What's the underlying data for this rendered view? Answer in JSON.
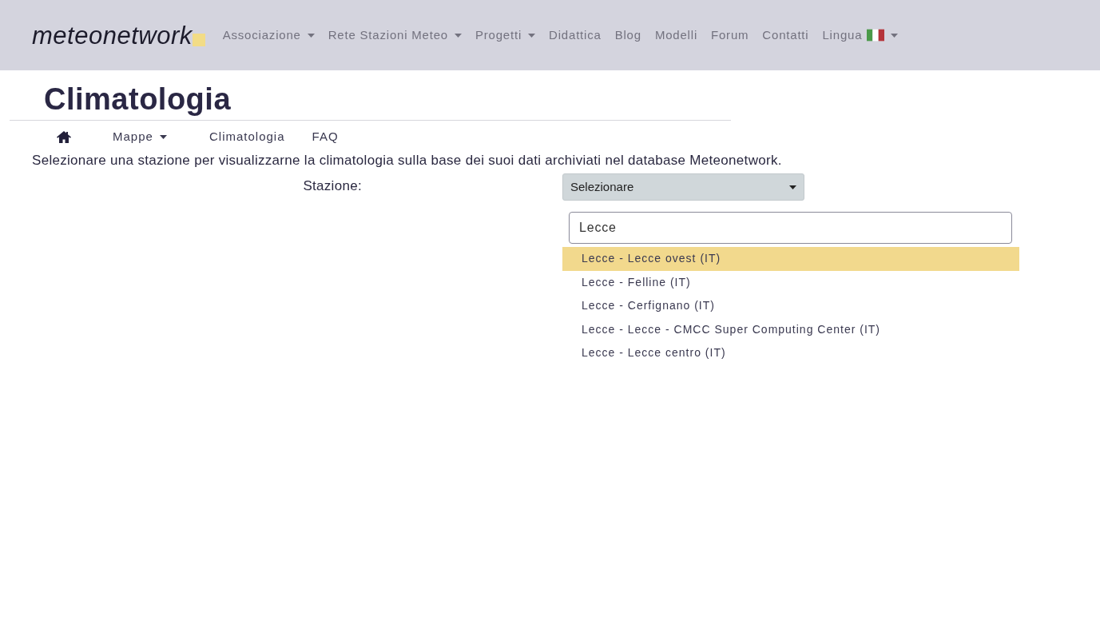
{
  "header": {
    "logo": "meteonetwork",
    "nav": [
      {
        "label": "Associazione",
        "kind": "menu"
      },
      {
        "label": "Rete Stazioni Meteo",
        "kind": "menu"
      },
      {
        "label": "Progetti",
        "kind": "menu"
      },
      {
        "label": "Didattica",
        "kind": "link"
      },
      {
        "label": "Blog",
        "kind": "link"
      },
      {
        "label": "Modelli",
        "kind": "link"
      },
      {
        "label": "Forum",
        "kind": "link"
      },
      {
        "label": "Contatti",
        "kind": "link"
      },
      {
        "label": "Lingua",
        "kind": "language"
      }
    ]
  },
  "page_title": "Climatologia",
  "subnav": [
    {
      "kind": "home"
    },
    {
      "label": "Mappe",
      "kind": "menu"
    },
    {
      "label": "Climatologia",
      "kind": "link"
    },
    {
      "label": "FAQ",
      "kind": "link"
    }
  ],
  "description": "Selezionare una stazione per visualizzarne la climatologia sulla base dei suoi dati archiviati nel database Meteonetwork.",
  "station": {
    "label": "Stazione:",
    "select_value": "Selezionare",
    "search_value": "Lecce",
    "options": [
      {
        "label": "Lecce - Lecce ovest (IT)",
        "selected": true
      },
      {
        "label": "Lecce - Felline (IT)",
        "selected": false
      },
      {
        "label": "Lecce - Cerfignano (IT)",
        "selected": false
      },
      {
        "label": "Lecce - Lecce - CMCC Super Computing Center (IT)",
        "selected": false
      },
      {
        "label": "Lecce - Lecce centro (IT)",
        "selected": false
      }
    ]
  }
}
